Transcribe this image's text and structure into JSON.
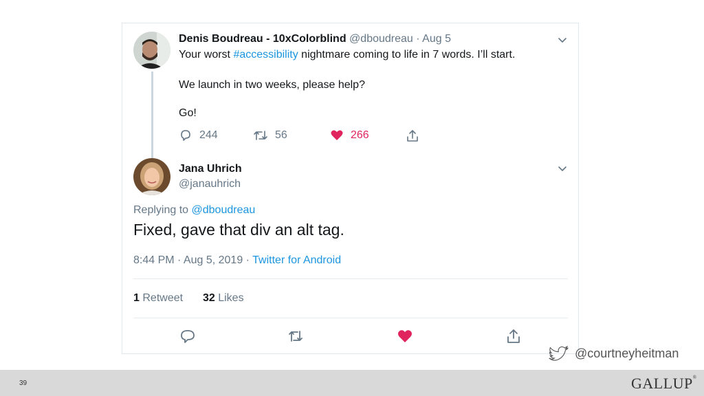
{
  "tweet1": {
    "author_name": "Denis Boudreau - 10xColorblind",
    "meta_handle": "@dboudreau",
    "meta_sep": "·",
    "meta_date": "Aug 5",
    "text_before": "Your worst ",
    "hashtag": "#accessibility",
    "text_after": " nightmare coming to life in 7 words. I’ll start.",
    "line2": "We launch in two weeks, please help?",
    "line3": "Go!",
    "replies": "244",
    "retweets": "56",
    "likes": "266"
  },
  "tweet2": {
    "author_name": "Jana Uhrich",
    "handle": "@janauhrich",
    "replying_to_label": "Replying to ",
    "replying_to_handle": "@dboudreau",
    "text": "Fixed, gave that div an alt tag.",
    "timestamp": "8:44 PM · Aug 5, 2019 · ",
    "source": "Twitter for Android",
    "retweet_count": "1",
    "retweet_label": "Retweet",
    "like_count": "32",
    "like_label": "Likes"
  },
  "footer": {
    "page_number": "39",
    "brand": "GALLUP",
    "twitter_handle": "@courtneyheitman"
  },
  "colors": {
    "link": "#1b95e0",
    "like": "#e0245e",
    "muted": "#657786",
    "footer_bar": "#d9d9d9"
  },
  "icons": [
    "chevron-down-icon",
    "reply-icon",
    "retweet-icon",
    "heart-icon",
    "share-icon",
    "twitter-bird-icon"
  ]
}
